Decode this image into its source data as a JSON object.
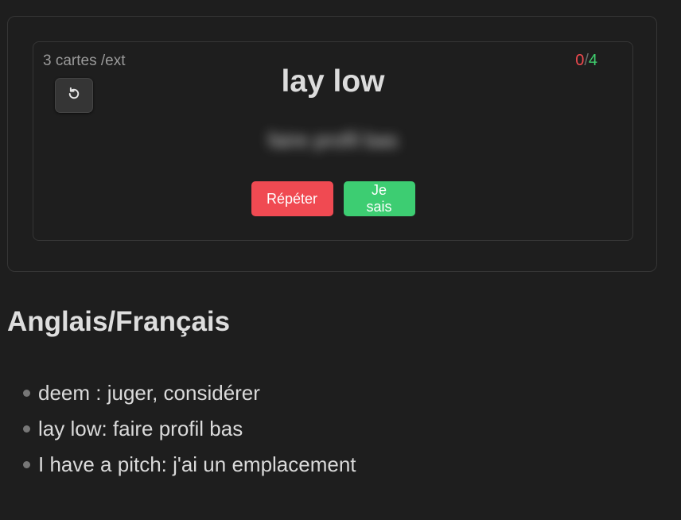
{
  "flashcard": {
    "card_count": "3 cartes /ext",
    "score": {
      "wrong": "0",
      "separator": "/",
      "right": "4",
      "wrong_color": "#ef4a4f",
      "right_color": "#3fce6e"
    },
    "reset_icon": "rotate-ccw-icon",
    "term": "lay low",
    "answer_hidden": "faire profil bas",
    "buttons": {
      "repeat": "Répéter",
      "know": "Je sais",
      "repeat_color": "#f04a52",
      "know_color": "#3dcd72"
    }
  },
  "section": {
    "title": "Anglais/Français",
    "items": [
      "deem : juger, considérer",
      "lay low: faire profil bas",
      "I have a pitch: j'ai un emplacement"
    ]
  }
}
